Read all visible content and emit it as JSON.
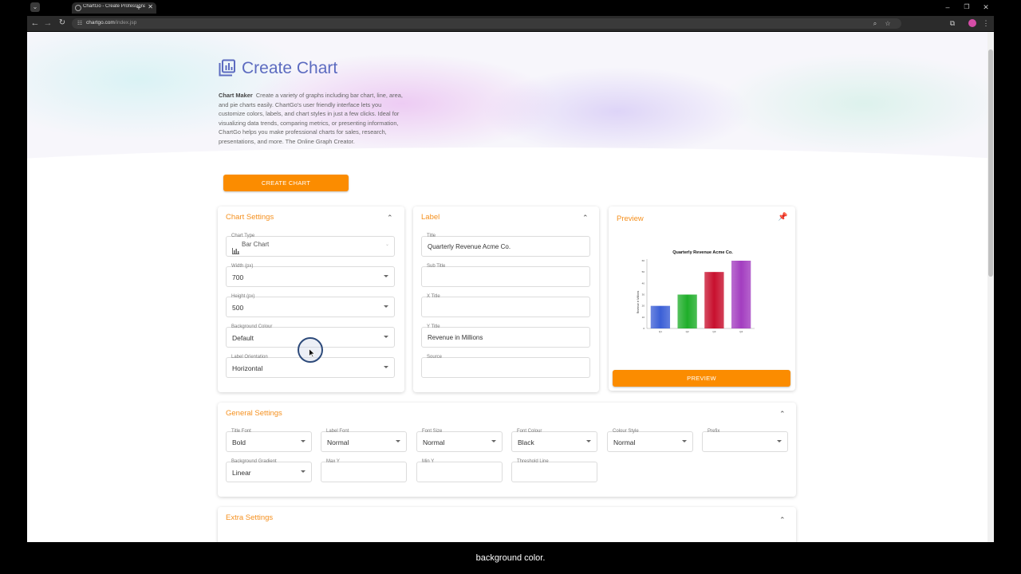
{
  "browser": {
    "tab_title": "ChartGo - Create Professional C",
    "url_host": "chartgo.com",
    "url_path": "/index.jsp"
  },
  "page": {
    "title": "Create Chart",
    "intro_bold": "Chart Maker",
    "intro_text": "Create a variety of graphs including bar chart, line, area, and pie charts easily. ChartGo's user friendly interface lets you customize colors, labels, and chart styles in just a few clicks. Ideal for visualizing data trends, comparing metrics, or presenting information, ChartGo helps you make professional charts for sales, research, presentations, and more. The Online Graph Creator.",
    "create_button": "CREATE CHART"
  },
  "chart_settings": {
    "title": "Chart Settings",
    "fields": [
      {
        "label": "Chart Type",
        "value": "Bar Chart"
      },
      {
        "label": "Width (px)",
        "value": "700"
      },
      {
        "label": "Height (px)",
        "value": "500"
      },
      {
        "label": "Background Colour",
        "value": "Default"
      },
      {
        "label": "Label Orientation",
        "value": "Horizontal"
      }
    ]
  },
  "label_settings": {
    "title": "Label",
    "fields": [
      {
        "label": "Title",
        "value": "Quarterly Revenue Acme Co."
      },
      {
        "label": "Sub Title",
        "value": ""
      },
      {
        "label": "X Title",
        "value": ""
      },
      {
        "label": "Y Title",
        "value": "Revenue in Millions"
      },
      {
        "label": "Source",
        "value": ""
      }
    ]
  },
  "preview": {
    "title": "Preview",
    "button": "PREVIEW"
  },
  "chart_data": {
    "type": "bar",
    "title": "Quarterly Revenue Acme Co.",
    "xlabel": "",
    "ylabel": "Revenue in Millions",
    "categories": [
      "Q1",
      "Q2",
      "Q3",
      "Q4"
    ],
    "values": [
      20,
      30,
      50,
      60
    ],
    "yticks": [
      "0",
      "10",
      "20",
      "30",
      "40",
      "50",
      "60"
    ],
    "ylim": [
      0,
      60
    ],
    "colors": [
      "#3b5fd6",
      "#1fae2a",
      "#c8102e",
      "#a33dc0"
    ]
  },
  "general_settings": {
    "title": "General Settings",
    "fields": [
      {
        "label": "Title Font",
        "value": "Bold"
      },
      {
        "label": "Label Font",
        "value": "Normal"
      },
      {
        "label": "Font Size",
        "value": "Normal"
      },
      {
        "label": "Font Colour",
        "value": "Black"
      },
      {
        "label": "Colour Style",
        "value": "Normal"
      },
      {
        "label": "Prefix",
        "value": ""
      },
      {
        "label": "Background Gradient",
        "value": "Linear"
      },
      {
        "label": "Max Y",
        "value": ""
      },
      {
        "label": "Min Y",
        "value": ""
      },
      {
        "label": "Threshold Line",
        "value": ""
      }
    ]
  },
  "extra_settings": {
    "title": "Extra Settings"
  },
  "caption": "background color."
}
